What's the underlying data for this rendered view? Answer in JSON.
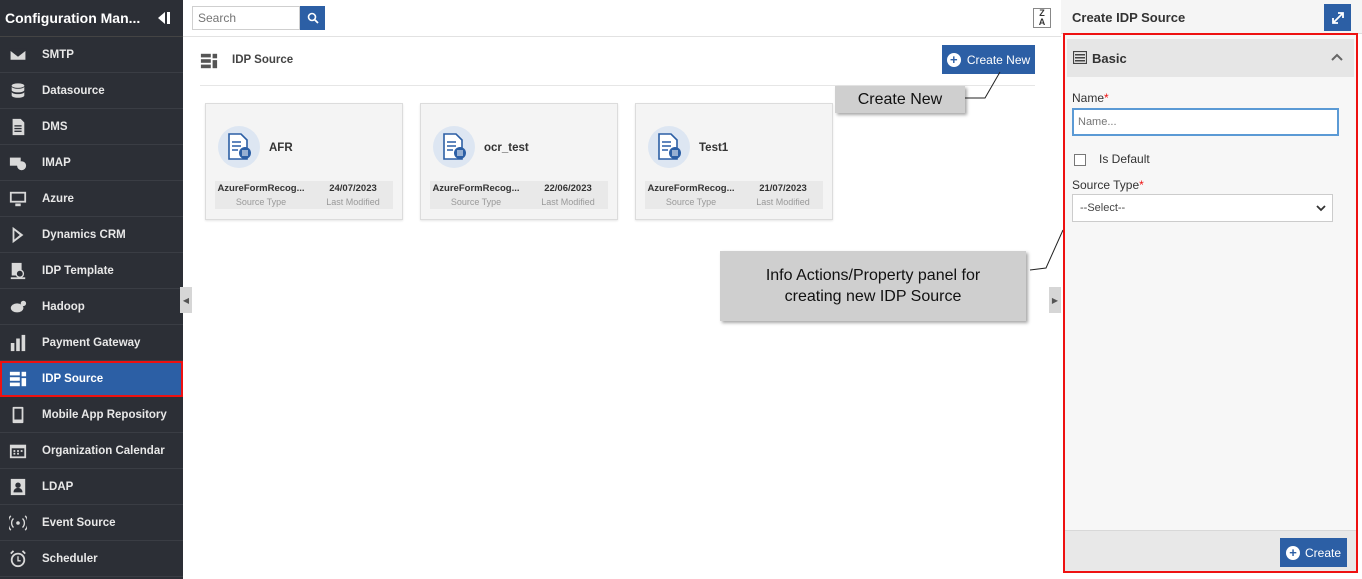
{
  "sidebar": {
    "title": "Configuration Man...",
    "items": [
      {
        "label": "SMTP",
        "icon": "mail-icon"
      },
      {
        "label": "Datasource",
        "icon": "database-icon"
      },
      {
        "label": "DMS",
        "icon": "document-icon"
      },
      {
        "label": "IMAP",
        "icon": "imap-icon"
      },
      {
        "label": "Azure",
        "icon": "monitor-icon"
      },
      {
        "label": "Dynamics CRM",
        "icon": "dynamics-icon"
      },
      {
        "label": "IDP Template",
        "icon": "template-icon"
      },
      {
        "label": "Hadoop",
        "icon": "hadoop-icon"
      },
      {
        "label": "Payment Gateway",
        "icon": "payment-icon"
      },
      {
        "label": "IDP Source",
        "icon": "idp-source-icon",
        "active": true
      },
      {
        "label": "Mobile App Repository",
        "icon": "mobile-app-icon"
      },
      {
        "label": "Organization Calendar",
        "icon": "calendar-icon"
      },
      {
        "label": "LDAP",
        "icon": "contact-icon"
      },
      {
        "label": "Event Source",
        "icon": "broadcast-icon"
      },
      {
        "label": "Scheduler",
        "icon": "alarm-icon"
      }
    ]
  },
  "topbar": {
    "search_placeholder": "Search",
    "sort_label_top": "Z",
    "sort_label_bottom": "A"
  },
  "main": {
    "title": "IDP Source",
    "create_new_label": "Create New",
    "cards": [
      {
        "name": "AFR",
        "source_type": "AzureFormRecog...",
        "last_modified": "24/07/2023",
        "source_type_label": "Source Type",
        "last_modified_label": "Last Modified"
      },
      {
        "name": "ocr_test",
        "source_type": "AzureFormRecog...",
        "last_modified": "22/06/2023",
        "source_type_label": "Source Type",
        "last_modified_label": "Last Modified"
      },
      {
        "name": "Test1",
        "source_type": "AzureFormRecog...",
        "last_modified": "21/07/2023",
        "source_type_label": "Source Type",
        "last_modified_label": "Last Modified"
      }
    ]
  },
  "callouts": {
    "create_new": "Create New",
    "panel_line1": "Info Actions/Property panel for",
    "panel_line2": "creating new IDP Source"
  },
  "panel": {
    "title": "Create IDP Source",
    "section_title": "Basic",
    "name_label": "Name",
    "required_mark": "*",
    "name_placeholder": "Name...",
    "is_default_label": "Is Default",
    "source_type_label": "Source Type",
    "source_type_value": "--Select--",
    "create_label": "Create"
  },
  "colors": {
    "accent": "#2c5fa5",
    "sidebar_bg": "#2c2f36",
    "highlight": "#e11111"
  }
}
